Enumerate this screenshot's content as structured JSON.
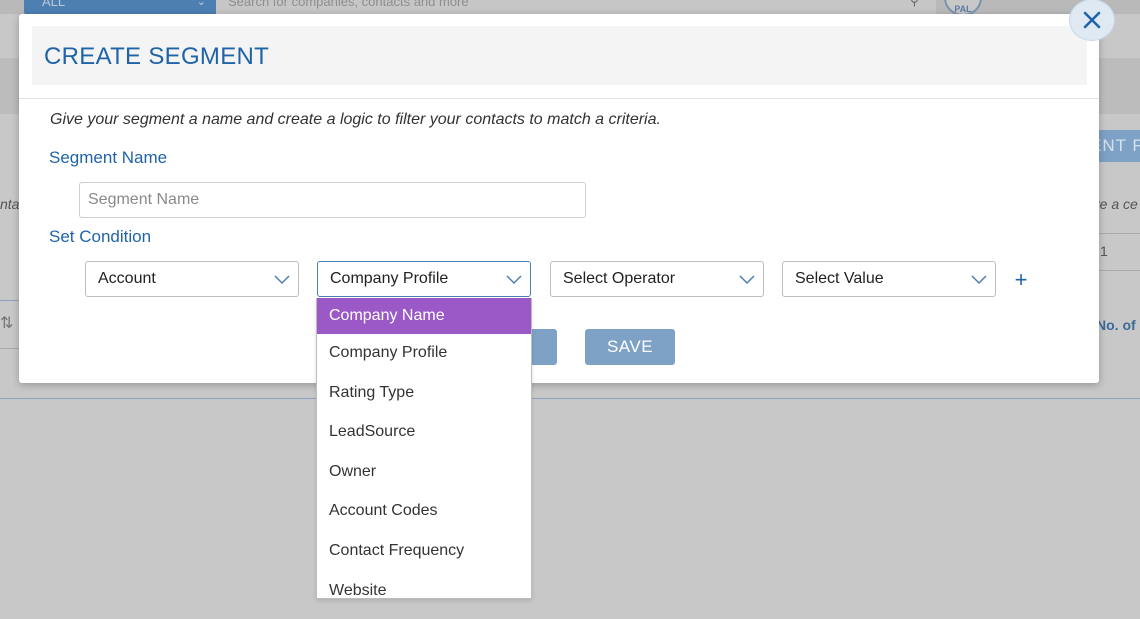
{
  "background": {
    "scope_label": "ALL",
    "search_placeholder": "Search for companies, contacts and more",
    "avatar_initials": "PAL",
    "segment_button_label": "ENT F",
    "right_text_1": "re a ce",
    "right_text_2": "1",
    "right_text_3": "No. of",
    "left_text": "nta",
    "left_sort_icon": "sort-icon"
  },
  "modal": {
    "title": "CREATE SEGMENT",
    "intro": "Give your segment a name and create a logic to filter your contacts to match a criteria.",
    "segment_name_label": "Segment Name",
    "segment_name_placeholder": "Segment Name",
    "segment_name_value": "",
    "set_condition_label": "Set Condition",
    "condition": {
      "entity": "Account",
      "field": "Company Profile",
      "operator": "Select Operator",
      "value": "Select Value"
    },
    "add_condition_label": "+",
    "save_label": "SAVE",
    "close_icon": "close-icon"
  },
  "dropdown": {
    "items": [
      {
        "label": "Company Name"
      },
      {
        "label": "Company Profile"
      },
      {
        "label": "Rating Type"
      },
      {
        "label": "LeadSource"
      },
      {
        "label": "Owner"
      },
      {
        "label": "Account Codes"
      },
      {
        "label": "Contact Frequency"
      },
      {
        "label": "Website"
      }
    ],
    "highlighted": "Company Name"
  },
  "colors": {
    "accent": "#1f63a8",
    "button": "#7ea2c6",
    "highlight": "#9b59c8"
  }
}
